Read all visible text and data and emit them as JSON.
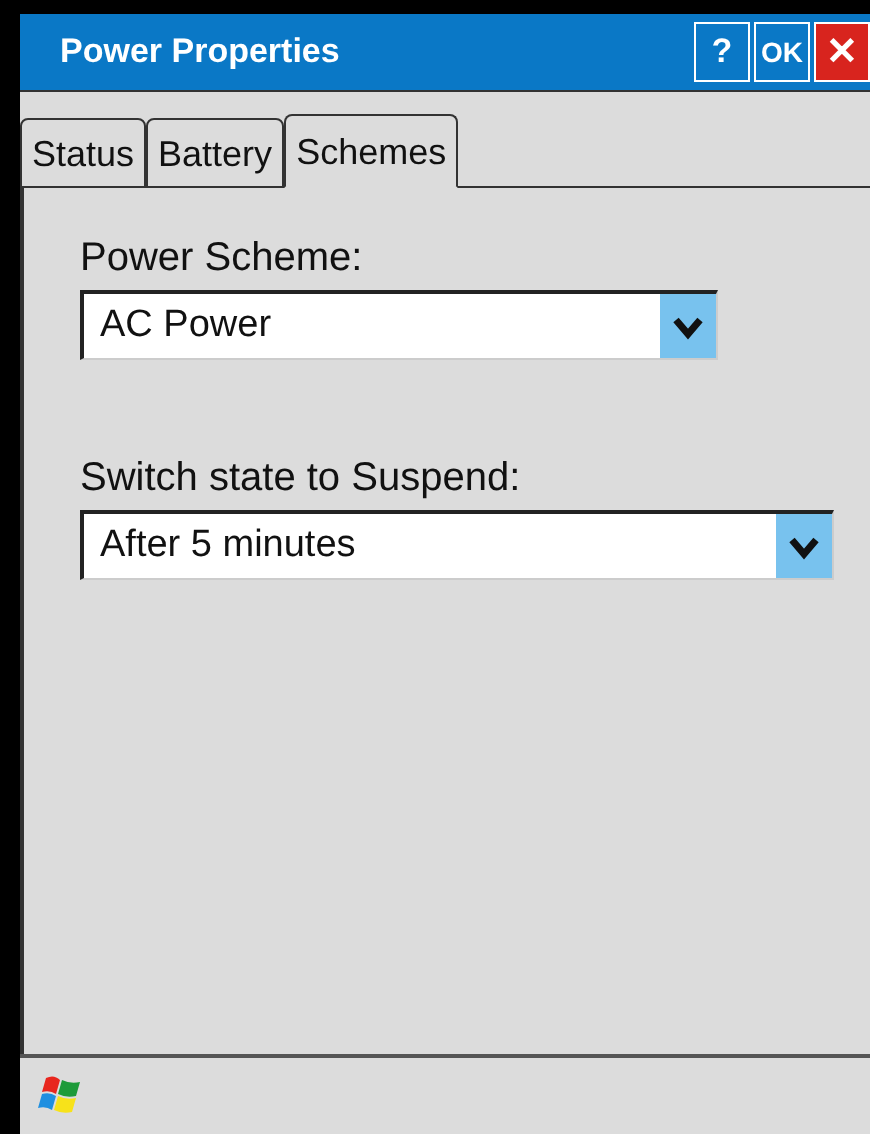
{
  "window": {
    "title": "Power Properties",
    "buttons": [
      {
        "kind": "help",
        "label": "?"
      },
      {
        "kind": "ok",
        "label": "OK"
      },
      {
        "kind": "close",
        "label": "✕"
      }
    ]
  },
  "tabs": [
    {
      "label": "Status",
      "selected": false
    },
    {
      "label": "Battery",
      "selected": false
    },
    {
      "label": "Schemes",
      "selected": true
    }
  ],
  "fields": [
    {
      "label": "Power Scheme:",
      "value": "AC Power",
      "wide": false
    },
    {
      "label": "Switch state to Suspend:",
      "value": "After 5 minutes",
      "wide": true
    }
  ]
}
